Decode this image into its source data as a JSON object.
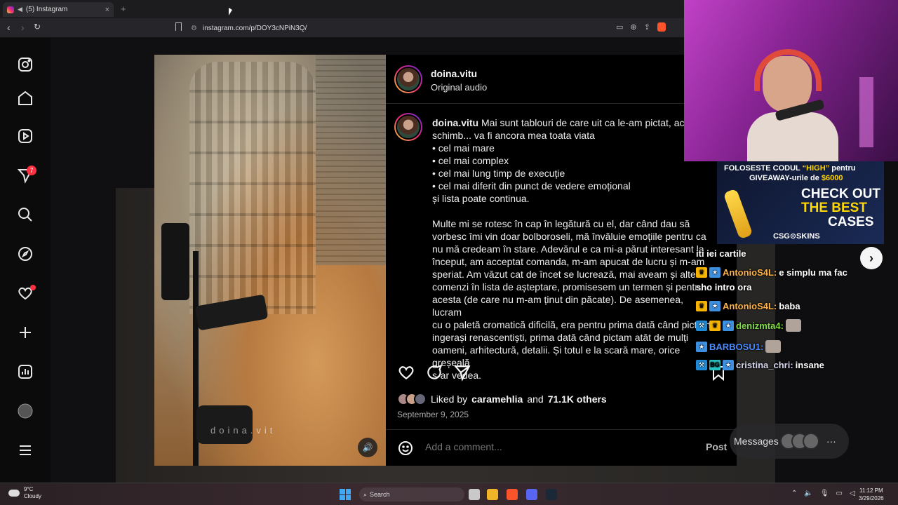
{
  "browser": {
    "tab_title": "(5) Instagram",
    "new_tab": "+",
    "close": "×",
    "url": "instagram.com/p/DOY3cNPiN3Q/"
  },
  "sidebar": {
    "notification_count": "7",
    "items": [
      "instagram-logo",
      "home",
      "reels",
      "messages",
      "search",
      "explore",
      "notifications",
      "create",
      "dashboard",
      "profile",
      "more"
    ]
  },
  "post": {
    "username": "doina.vitu",
    "audio": "Original audio",
    "caption_user": "doina.vitu",
    "caption_line1": "Mai sunt tablouri de care uit ca le-am pictat, aci",
    "caption_line2": "schimb... va fi ancora mea toata viata",
    "bullets": [
      "• cel mai mare",
      "• cel mai complex",
      "• cel mai lung timp de execuție",
      "• cel mai diferit din punct de vedere emoțional"
    ],
    "list_end": "și lista poate continua.",
    "paragraph_lines": [
      "Multe mi se rotesc în cap în legătură cu el, dar când dau să",
      "vorbesc îmi vin doar bolboroseli, mă învăluie emoțiile pentru ca",
      "nu mă credeam în stare. Adevărul e ca mi-a părut interesant la",
      "început, am acceptat comanda, m-am apucat de lucru și m-am",
      "speriat. Am văzut cat de încet se lucrează, mai aveam și alte",
      "comenzi în lista de așteptare, promisesem un termen și pentru",
      "acesta (de care nu m-am ținut din păcate). De asemenea, lucram",
      "cu o paletă cromatică dificilă, era pentru prima dată când pictam",
      "ingerași renascentiști, prima dată când pictam atât de mulți",
      "oameni, arhitectură, detalii. Și totul e la scară mare, orice greșeală",
      "s-ar vedea."
    ],
    "watermark": "doina.vit",
    "liked_by_prefix": "Liked by",
    "liked_by_user": "caramehlia",
    "liked_by_and": "and",
    "liked_by_others": "71.1K others",
    "date": "September 9, 2025",
    "comment_placeholder": "Add a comment...",
    "post_label": "Post"
  },
  "messages_label": "Messages",
  "sponsor": {
    "line1_a": "FOLOSESTE CODUL",
    "line1_b": "“HIGH”",
    "line1_c": "pentru",
    "line2_a": "GIVEAWAY-urile de",
    "line2_b": "$6000",
    "big1": "CHECK OUT",
    "big2": "THE BEST",
    "big3": "CASES",
    "brand": "CSG⊙SKINS"
  },
  "chat": [
    {
      "user": "",
      "text": "iti iei cartile"
    },
    {
      "user": "AntonioS4L:",
      "text": "e simplu ma fac"
    },
    {
      "user": "",
      "text": "sho intro ora"
    },
    {
      "user": "AntonioS4L:",
      "text": "baba"
    },
    {
      "user": "denizmta4:",
      "text": ""
    },
    {
      "user": "BARBOSU1:",
      "text": ""
    },
    {
      "user": "cristina_chri:",
      "text": "insane"
    }
  ],
  "taskbar": {
    "temp": "9°C",
    "weather": "Cloudy",
    "search": "Search",
    "time": "11:12 PM",
    "date": "3/29/2026"
  }
}
